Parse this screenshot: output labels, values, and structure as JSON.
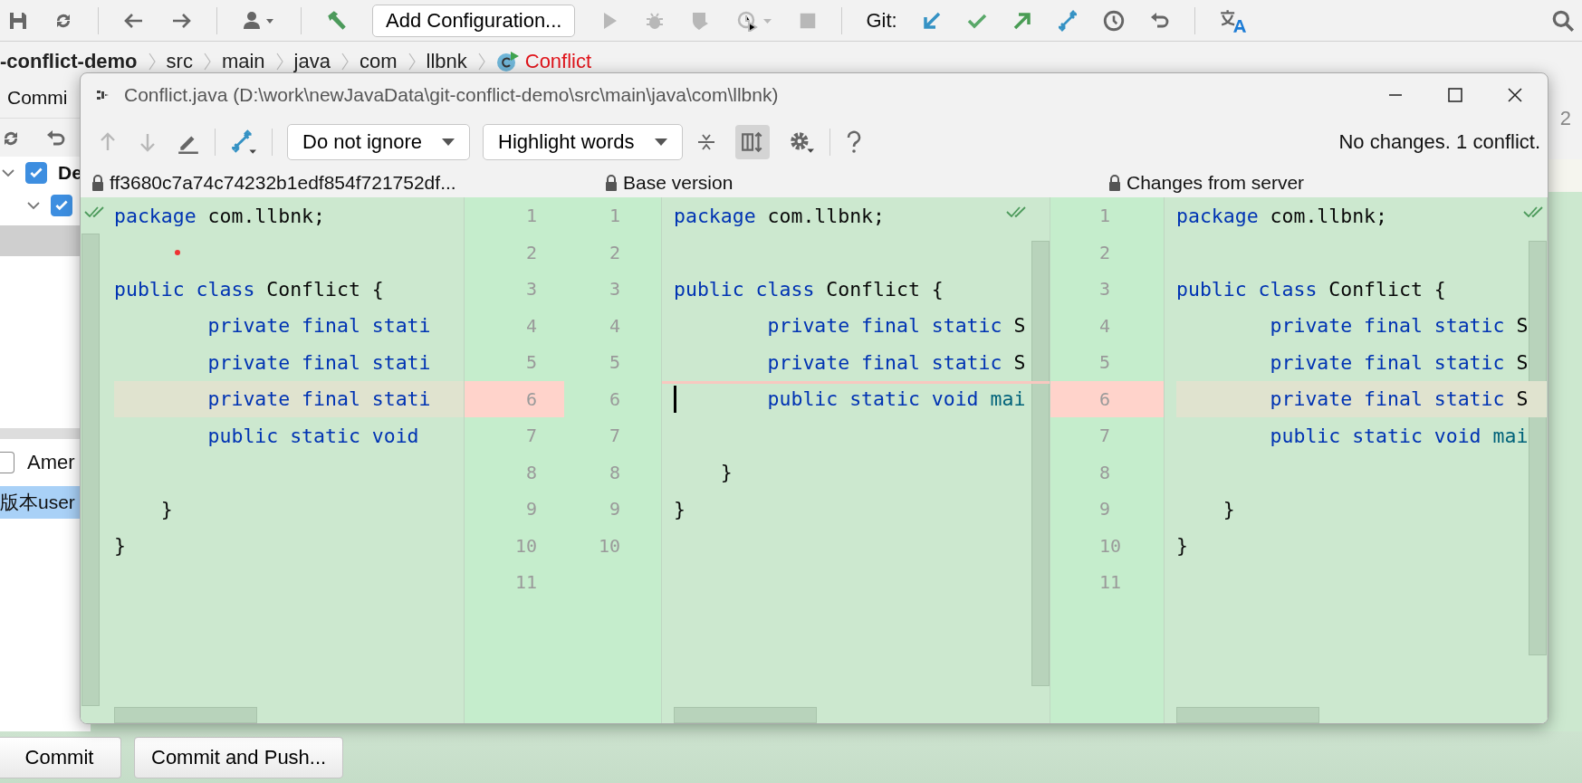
{
  "toolbar": {
    "config_button": "Add Configuration...",
    "run_disabled": true,
    "git_label": "Git:"
  },
  "breadcrumb": [
    {
      "text": "-conflict-demo",
      "kind": "project"
    },
    {
      "text": "src",
      "kind": "dir"
    },
    {
      "text": "main",
      "kind": "dir"
    },
    {
      "text": "java",
      "kind": "dir"
    },
    {
      "text": "com",
      "kind": "dir"
    },
    {
      "text": "llbnk",
      "kind": "dir"
    },
    {
      "text": "Conflict",
      "kind": "class"
    }
  ],
  "commit_panel": {
    "tab": "Commi",
    "tree": [
      {
        "label": "De",
        "checked": true,
        "expanded": true,
        "children": [
          {
            "checked": true,
            "expanded": true
          }
        ]
      }
    ],
    "amend": {
      "label": "Amer",
      "checked": false
    },
    "message": "版本user",
    "buttons": [
      {
        "label": "Commit",
        "kind": "primary"
      },
      {
        "label": "Commit and Push...",
        "kind": "normal"
      }
    ]
  },
  "editor": {
    "side_count": "2"
  },
  "dialog": {
    "title": "Conflict.java (D:\\work\\newJavaData\\git-conflict-demo\\src\\main\\java\\com\\llbnk)",
    "nav_disabled": true,
    "ignore_dropdown": "Do not ignore",
    "highlight_dropdown": "Highlight words",
    "sync_scroll_on": true,
    "status": "No changes. 1 conflict.",
    "panes": [
      {
        "kind": "side",
        "header": "ff3680c7a74c74232b1edf854f721752df...",
        "status_ok": true,
        "lines": [
          {
            "num": "1",
            "segs": [
              {
                "t": "package",
                "kind": "kw"
              },
              {
                "t": " com.llbnk;",
                "kind": "plain"
              }
            ]
          },
          {
            "num": "2",
            "mark": true
          },
          {
            "num": "3",
            "segs": [
              {
                "t": "public class",
                "kind": "kw"
              },
              {
                "t": " Conflict {",
                "kind": "plain"
              }
            ]
          },
          {
            "num": "4",
            "segs": [
              {
                "t": "        private final stati",
                "kind": "kw"
              }
            ]
          },
          {
            "num": "5",
            "segs": [
              {
                "t": "        private final stati",
                "kind": "kw"
              }
            ]
          },
          {
            "num": "6",
            "conflict": true,
            "segs": [
              {
                "t": "        private final stati",
                "kind": "kw"
              }
            ]
          },
          {
            "num": "7",
            "segs": [
              {
                "t": "        public static void",
                "kind": "kw"
              }
            ]
          },
          {
            "num": "8"
          },
          {
            "num": "9",
            "segs": [
              {
                "t": "    }",
                "kind": "plain"
              }
            ]
          },
          {
            "num": "10",
            "segs": [
              {
                "t": "}",
                "kind": "plain"
              }
            ]
          },
          {
            "num": "11"
          }
        ]
      },
      {
        "kind": "base",
        "header": "Base version",
        "status_ok": true,
        "lines": [
          {
            "num": "1",
            "segs": [
              {
                "t": "package",
                "kind": "kw"
              },
              {
                "t": " com.llbnk;",
                "kind": "plain"
              }
            ]
          },
          {
            "num": "2"
          },
          {
            "num": "3",
            "segs": [
              {
                "t": "public class",
                "kind": "kw"
              },
              {
                "t": " Conflict {",
                "kind": "plain"
              }
            ]
          },
          {
            "num": "4",
            "segs": [
              {
                "t": "        private final static",
                "kind": "kw"
              },
              {
                "t": " S",
                "kind": "plain"
              }
            ]
          },
          {
            "num": "5",
            "segs": [
              {
                "t": "        private final static",
                "kind": "kw"
              },
              {
                "t": " S",
                "kind": "plain"
              }
            ]
          },
          {
            "num": "6",
            "conflict": true,
            "caret": true,
            "segs": [
              {
                "t": "        public static void",
                "kind": "kw"
              },
              {
                "t": " mai",
                "kind": "method"
              }
            ]
          },
          {
            "num": "7"
          },
          {
            "num": "8",
            "segs": [
              {
                "t": "    }",
                "kind": "plain"
              }
            ]
          },
          {
            "num": "9",
            "segs": [
              {
                "t": "}",
                "kind": "plain"
              }
            ]
          },
          {
            "num": "10"
          }
        ]
      },
      {
        "kind": "side",
        "header": "Changes from server",
        "status_ok": true,
        "lines": [
          {
            "num": "1",
            "segs": [
              {
                "t": "package",
                "kind": "kw"
              },
              {
                "t": " com.llbnk;",
                "kind": "plain"
              }
            ]
          },
          {
            "num": "2"
          },
          {
            "num": "3",
            "segs": [
              {
                "t": "public class",
                "kind": "kw"
              },
              {
                "t": " Conflict {",
                "kind": "plain"
              }
            ]
          },
          {
            "num": "4",
            "segs": [
              {
                "t": "        private final static",
                "kind": "kw"
              },
              {
                "t": " S",
                "kind": "plain"
              }
            ]
          },
          {
            "num": "5",
            "segs": [
              {
                "t": "        private final static",
                "kind": "kw"
              },
              {
                "t": " S",
                "kind": "plain"
              }
            ]
          },
          {
            "num": "6",
            "conflict": true,
            "segs": [
              {
                "t": "        private final static",
                "kind": "kw"
              },
              {
                "t": " S",
                "kind": "plain"
              }
            ]
          },
          {
            "num": "7",
            "segs": [
              {
                "t": "        public static void",
                "kind": "kw"
              },
              {
                "t": " mai",
                "kind": "method"
              }
            ]
          },
          {
            "num": "8"
          },
          {
            "num": "9",
            "segs": [
              {
                "t": "    }",
                "kind": "plain"
              }
            ]
          },
          {
            "num": "10",
            "segs": [
              {
                "t": "}",
                "kind": "plain"
              }
            ]
          },
          {
            "num": "11"
          }
        ]
      }
    ]
  }
}
